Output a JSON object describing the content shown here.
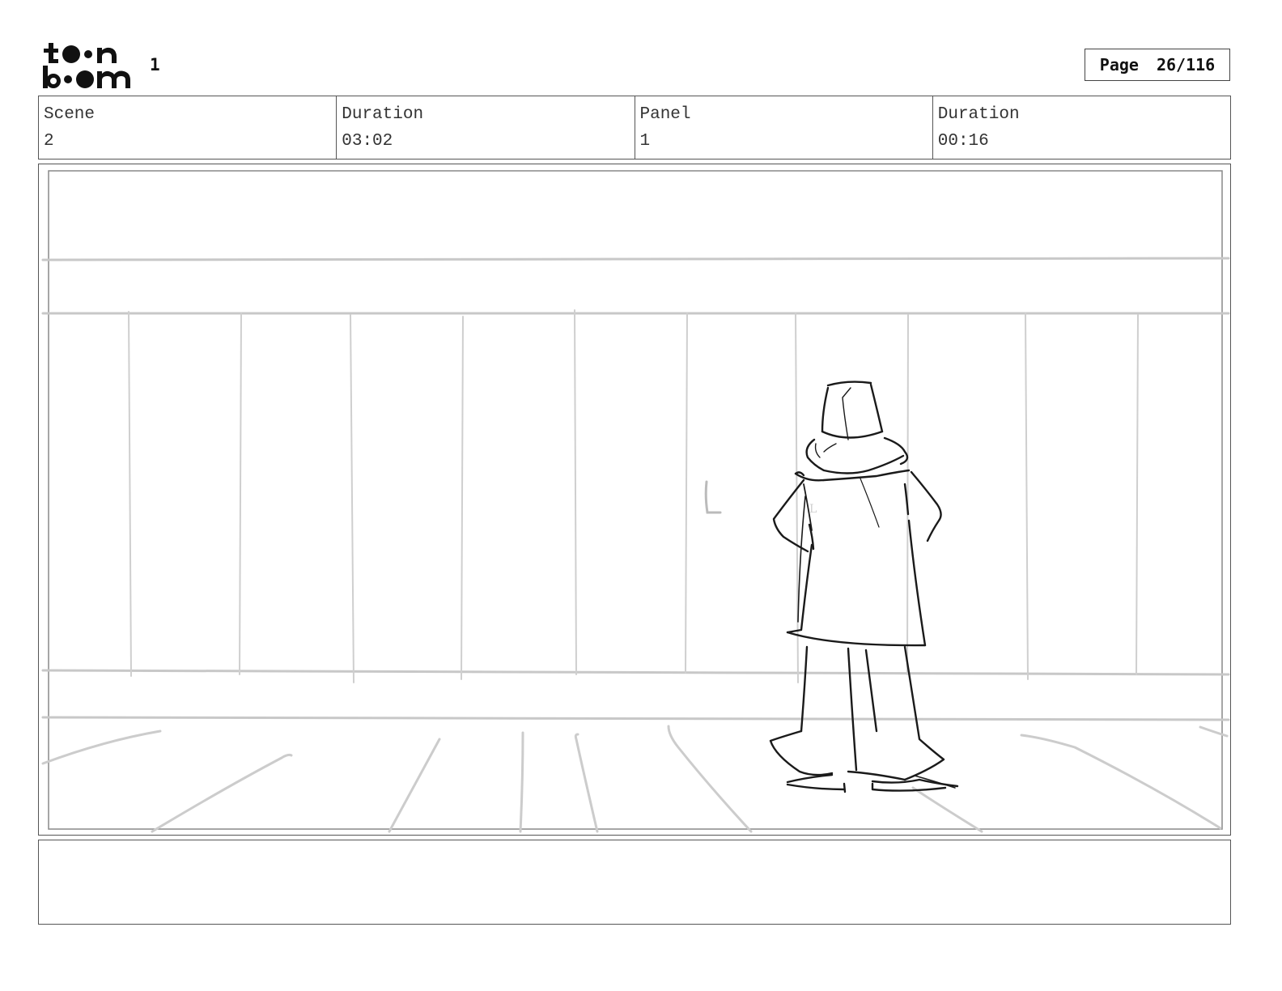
{
  "header": {
    "logo_text": "toon boom",
    "sheet_number": "1",
    "page_label": "Page",
    "page_value": "26/116"
  },
  "info": {
    "scene_label": "Scene",
    "scene_value": "2",
    "scene_duration_label": "Duration",
    "scene_duration_value": "03:02",
    "panel_label": "Panel",
    "panel_value": "1",
    "panel_duration_label": "Duration",
    "panel_duration_value": "00:16"
  },
  "panel": {
    "sketch_letter": "L"
  },
  "notes": {
    "text": ""
  }
}
